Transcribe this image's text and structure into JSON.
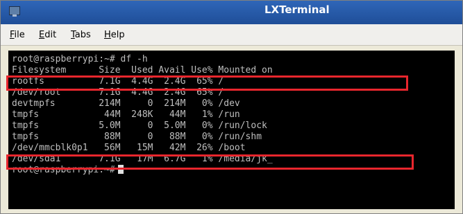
{
  "window": {
    "title": "LXTerminal",
    "icon": "terminal-icon"
  },
  "menu": [
    {
      "label": "File",
      "key": "F",
      "rest": "ile"
    },
    {
      "label": "Edit",
      "key": "E",
      "rest": "dit"
    },
    {
      "label": "Tabs",
      "key": "T",
      "rest": "abs"
    },
    {
      "label": "Help",
      "key": "H",
      "rest": "elp"
    }
  ],
  "terminal": {
    "lines": [
      "root@raspberrypi:~# df -h",
      "Filesystem      Size  Used Avail Use% Mounted on",
      "rootfs          7.1G  4.4G  2.4G  65% /",
      "/dev/root       7.1G  4.4G  2.4G  65% /",
      "devtmpfs        214M     0  214M   0% /dev",
      "tmpfs            44M  248K   44M   1% /run",
      "tmpfs           5.0M     0  5.0M   0% /run/lock",
      "tmpfs            88M     0   88M   0% /run/shm",
      "/dev/mmcblk0p1   56M   15M   42M  26% /boot",
      "/dev/sda1       7.1G   17M  6.7G   1% /media/jk_",
      "root@raspberrypi:~#"
    ]
  },
  "highlight_color": "#e8262d"
}
